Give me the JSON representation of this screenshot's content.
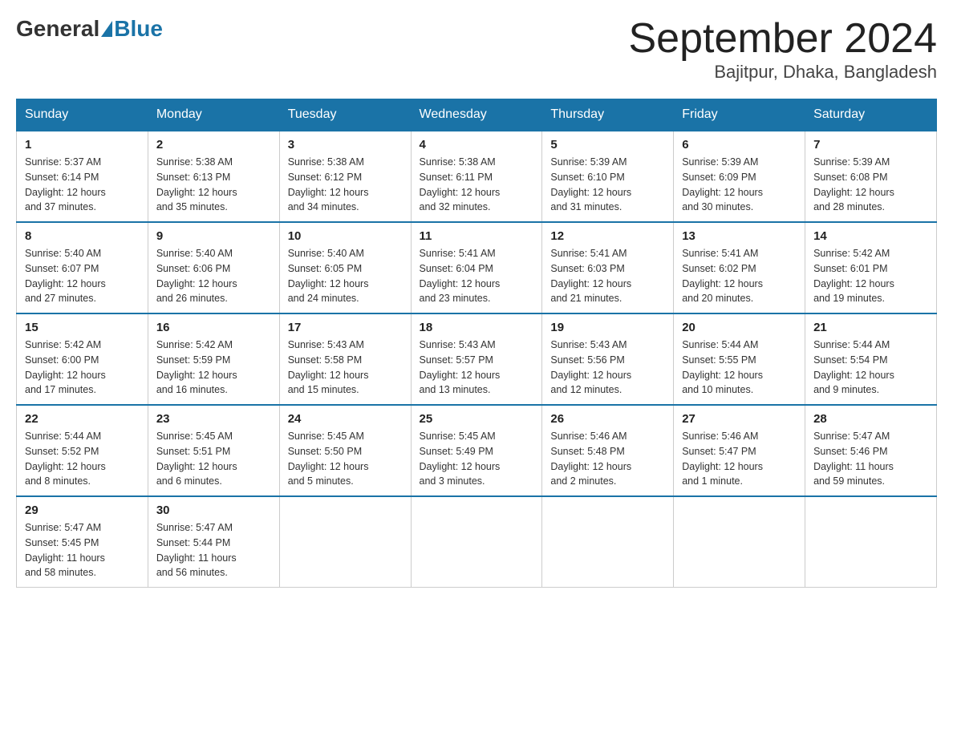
{
  "header": {
    "logo_general": "General",
    "logo_blue": "Blue",
    "month_year": "September 2024",
    "location": "Bajitpur, Dhaka, Bangladesh"
  },
  "weekdays": [
    "Sunday",
    "Monday",
    "Tuesday",
    "Wednesday",
    "Thursday",
    "Friday",
    "Saturday"
  ],
  "weeks": [
    [
      {
        "day": "1",
        "sunrise": "5:37 AM",
        "sunset": "6:14 PM",
        "daylight": "12 hours and 37 minutes."
      },
      {
        "day": "2",
        "sunrise": "5:38 AM",
        "sunset": "6:13 PM",
        "daylight": "12 hours and 35 minutes."
      },
      {
        "day": "3",
        "sunrise": "5:38 AM",
        "sunset": "6:12 PM",
        "daylight": "12 hours and 34 minutes."
      },
      {
        "day": "4",
        "sunrise": "5:38 AM",
        "sunset": "6:11 PM",
        "daylight": "12 hours and 32 minutes."
      },
      {
        "day": "5",
        "sunrise": "5:39 AM",
        "sunset": "6:10 PM",
        "daylight": "12 hours and 31 minutes."
      },
      {
        "day": "6",
        "sunrise": "5:39 AM",
        "sunset": "6:09 PM",
        "daylight": "12 hours and 30 minutes."
      },
      {
        "day": "7",
        "sunrise": "5:39 AM",
        "sunset": "6:08 PM",
        "daylight": "12 hours and 28 minutes."
      }
    ],
    [
      {
        "day": "8",
        "sunrise": "5:40 AM",
        "sunset": "6:07 PM",
        "daylight": "12 hours and 27 minutes."
      },
      {
        "day": "9",
        "sunrise": "5:40 AM",
        "sunset": "6:06 PM",
        "daylight": "12 hours and 26 minutes."
      },
      {
        "day": "10",
        "sunrise": "5:40 AM",
        "sunset": "6:05 PM",
        "daylight": "12 hours and 24 minutes."
      },
      {
        "day": "11",
        "sunrise": "5:41 AM",
        "sunset": "6:04 PM",
        "daylight": "12 hours and 23 minutes."
      },
      {
        "day": "12",
        "sunrise": "5:41 AM",
        "sunset": "6:03 PM",
        "daylight": "12 hours and 21 minutes."
      },
      {
        "day": "13",
        "sunrise": "5:41 AM",
        "sunset": "6:02 PM",
        "daylight": "12 hours and 20 minutes."
      },
      {
        "day": "14",
        "sunrise": "5:42 AM",
        "sunset": "6:01 PM",
        "daylight": "12 hours and 19 minutes."
      }
    ],
    [
      {
        "day": "15",
        "sunrise": "5:42 AM",
        "sunset": "6:00 PM",
        "daylight": "12 hours and 17 minutes."
      },
      {
        "day": "16",
        "sunrise": "5:42 AM",
        "sunset": "5:59 PM",
        "daylight": "12 hours and 16 minutes."
      },
      {
        "day": "17",
        "sunrise": "5:43 AM",
        "sunset": "5:58 PM",
        "daylight": "12 hours and 15 minutes."
      },
      {
        "day": "18",
        "sunrise": "5:43 AM",
        "sunset": "5:57 PM",
        "daylight": "12 hours and 13 minutes."
      },
      {
        "day": "19",
        "sunrise": "5:43 AM",
        "sunset": "5:56 PM",
        "daylight": "12 hours and 12 minutes."
      },
      {
        "day": "20",
        "sunrise": "5:44 AM",
        "sunset": "5:55 PM",
        "daylight": "12 hours and 10 minutes."
      },
      {
        "day": "21",
        "sunrise": "5:44 AM",
        "sunset": "5:54 PM",
        "daylight": "12 hours and 9 minutes."
      }
    ],
    [
      {
        "day": "22",
        "sunrise": "5:44 AM",
        "sunset": "5:52 PM",
        "daylight": "12 hours and 8 minutes."
      },
      {
        "day": "23",
        "sunrise": "5:45 AM",
        "sunset": "5:51 PM",
        "daylight": "12 hours and 6 minutes."
      },
      {
        "day": "24",
        "sunrise": "5:45 AM",
        "sunset": "5:50 PM",
        "daylight": "12 hours and 5 minutes."
      },
      {
        "day": "25",
        "sunrise": "5:45 AM",
        "sunset": "5:49 PM",
        "daylight": "12 hours and 3 minutes."
      },
      {
        "day": "26",
        "sunrise": "5:46 AM",
        "sunset": "5:48 PM",
        "daylight": "12 hours and 2 minutes."
      },
      {
        "day": "27",
        "sunrise": "5:46 AM",
        "sunset": "5:47 PM",
        "daylight": "12 hours and 1 minute."
      },
      {
        "day": "28",
        "sunrise": "5:47 AM",
        "sunset": "5:46 PM",
        "daylight": "11 hours and 59 minutes."
      }
    ],
    [
      {
        "day": "29",
        "sunrise": "5:47 AM",
        "sunset": "5:45 PM",
        "daylight": "11 hours and 58 minutes."
      },
      {
        "day": "30",
        "sunrise": "5:47 AM",
        "sunset": "5:44 PM",
        "daylight": "11 hours and 56 minutes."
      },
      null,
      null,
      null,
      null,
      null
    ]
  ],
  "labels": {
    "sunrise_prefix": "Sunrise: ",
    "sunset_prefix": "Sunset: ",
    "daylight_prefix": "Daylight: "
  }
}
